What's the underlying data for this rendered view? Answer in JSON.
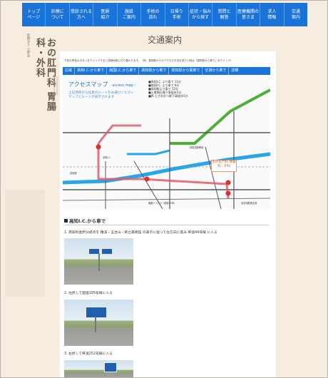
{
  "nav": {
    "items": [
      {
        "label": "トップ\nページ"
      },
      {
        "label": "診療に\nついて"
      },
      {
        "label": "受診される\n方へ"
      },
      {
        "label": "医師\n紹介"
      },
      {
        "label": "施設\nご案内"
      },
      {
        "label": "手術の\n流れ"
      },
      {
        "label": "日帰り\n手術"
      },
      {
        "label": "症状・悩み\nから探す"
      },
      {
        "label": "質問と\n解答"
      },
      {
        "label": "医療機関の\n皆さま"
      },
      {
        "label": "求人\n情報"
      },
      {
        "label": "交通\n案内"
      }
    ]
  },
  "logo": {
    "org": "医療法人\n小野会",
    "name": "おの肛門科\n胃腸科・外科",
    "sub": "Ono Proctology Gastroenterology & Surgery"
  },
  "page_title": "交通案内",
  "note": "下記の青色のボタンをクリックすると詳細地図に切り替わります。（例：高知駅からのアクセス方法を見たい時は「高知駅から車で」をクリック）",
  "tabs": [
    {
      "label": "広域"
    },
    {
      "label": "高知I.C.から車で"
    },
    {
      "label": "南国I.C.から車で"
    },
    {
      "label": "高知駅から車で"
    },
    {
      "label": "高知駅から電車で"
    },
    {
      "label": "空港から車で"
    },
    {
      "label": "詳細"
    }
  ],
  "map": {
    "title": "アクセスマップ",
    "title_en": "- access map -",
    "desc": "上記項目から任意のルートをお選びください\nマップとルートが表示されます",
    "list": "■高知I.C. より車で 11分\n■南国I.C. より車で 9分\n■高知駅より車で 12分\n■土電領石通下車徒歩5分\n■JR とさおおつ駅下車徒歩5分",
    "labels": {
      "highway": "高知自動車道",
      "kochi_station": "高知駅",
      "bypass": "南国バイパス（国道32号）",
      "airport": "至高知龍馬空港",
      "ic": "高知I.C.",
      "clinic": "おの肛門科\n胃腸科・外科"
    }
  },
  "section": {
    "heading": "高知I.C.から車で",
    "steps": [
      "1. 高知料金所分岐点を 稚渓・五台山・県立美術館 の表示に従って左方向に進み 県道44号線 に入る",
      "2. 左折して国道195号線に入る",
      "3. 右折して県道252号線に入る"
    ]
  },
  "colors": {
    "nav": "#1a73d9",
    "route": "#e05a6a",
    "highway": "#4caf3a",
    "river": "#29a6e8"
  }
}
